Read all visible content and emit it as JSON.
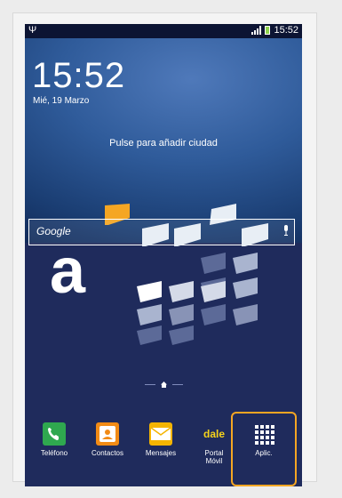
{
  "statusbar": {
    "usb_icon": "usb-icon",
    "time": "15:52"
  },
  "lockscreen": {
    "clock": "15:52",
    "date": "Mié, 19 Marzo",
    "weather_prompt": "Pulse para añadir ciudad"
  },
  "search": {
    "label": "Google",
    "mic_icon": "microphone-icon"
  },
  "brand": {
    "letter": "a"
  },
  "dock": [
    {
      "label": "Teléfono",
      "icon": "phone-icon",
      "color": "#2fa84f"
    },
    {
      "label": "Contactos",
      "icon": "contacts-icon",
      "color": "#f28b15"
    },
    {
      "label": "Mensajes",
      "icon": "messages-icon",
      "color": "#f4b400"
    },
    {
      "label": "Portal Móvil",
      "icon": "dale-icon",
      "brand_text": "dale",
      "color": "#f7d31a"
    },
    {
      "label": "Aplic.",
      "icon": "apps-grid-icon",
      "color": "#ffffff"
    }
  ],
  "accent_color": "#f5a623"
}
